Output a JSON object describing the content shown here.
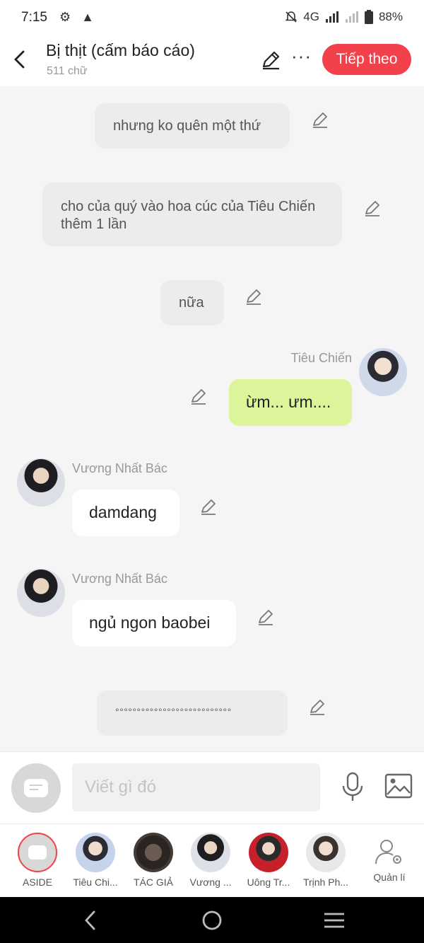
{
  "status_bar": {
    "time": "7:15",
    "network": "4G",
    "battery": "88%"
  },
  "header": {
    "back_icon": "chevron-left-icon",
    "title": "Bị thịt (cấm báo cáo)",
    "word_count": "511 chữ",
    "next_label": "Tiếp theo",
    "accent_color": "#f2414b"
  },
  "messages": [
    {
      "type": "narration",
      "text": "nhưng ko quên một thứ"
    },
    {
      "type": "narration",
      "text": "cho của quý vào hoa cúc của Tiêu Chiến thêm 1 lần"
    },
    {
      "type": "narration",
      "text": "nữa"
    },
    {
      "type": "right",
      "sender": "Tiêu Chiến",
      "text": "ừm... ưm...."
    },
    {
      "type": "left",
      "sender": "Vương Nhất Bác",
      "text": "damdang"
    },
    {
      "type": "left",
      "sender": "Vương Nhất Bác",
      "text": "ngủ ngon baobei"
    },
    {
      "type": "narration",
      "text": "°°°°°°°°°°°°°°°°°°°°°°°°°°°"
    }
  ],
  "input": {
    "placeholder": "Viết gì đó"
  },
  "characters": [
    {
      "label": "ASIDE"
    },
    {
      "label": "Tiêu Chi..."
    },
    {
      "label": "TÁC GIẢ"
    },
    {
      "label": "Vương ..."
    },
    {
      "label": "Uông Tr..."
    },
    {
      "label": "Trịnh Ph..."
    },
    {
      "label": "Quản lí"
    }
  ]
}
